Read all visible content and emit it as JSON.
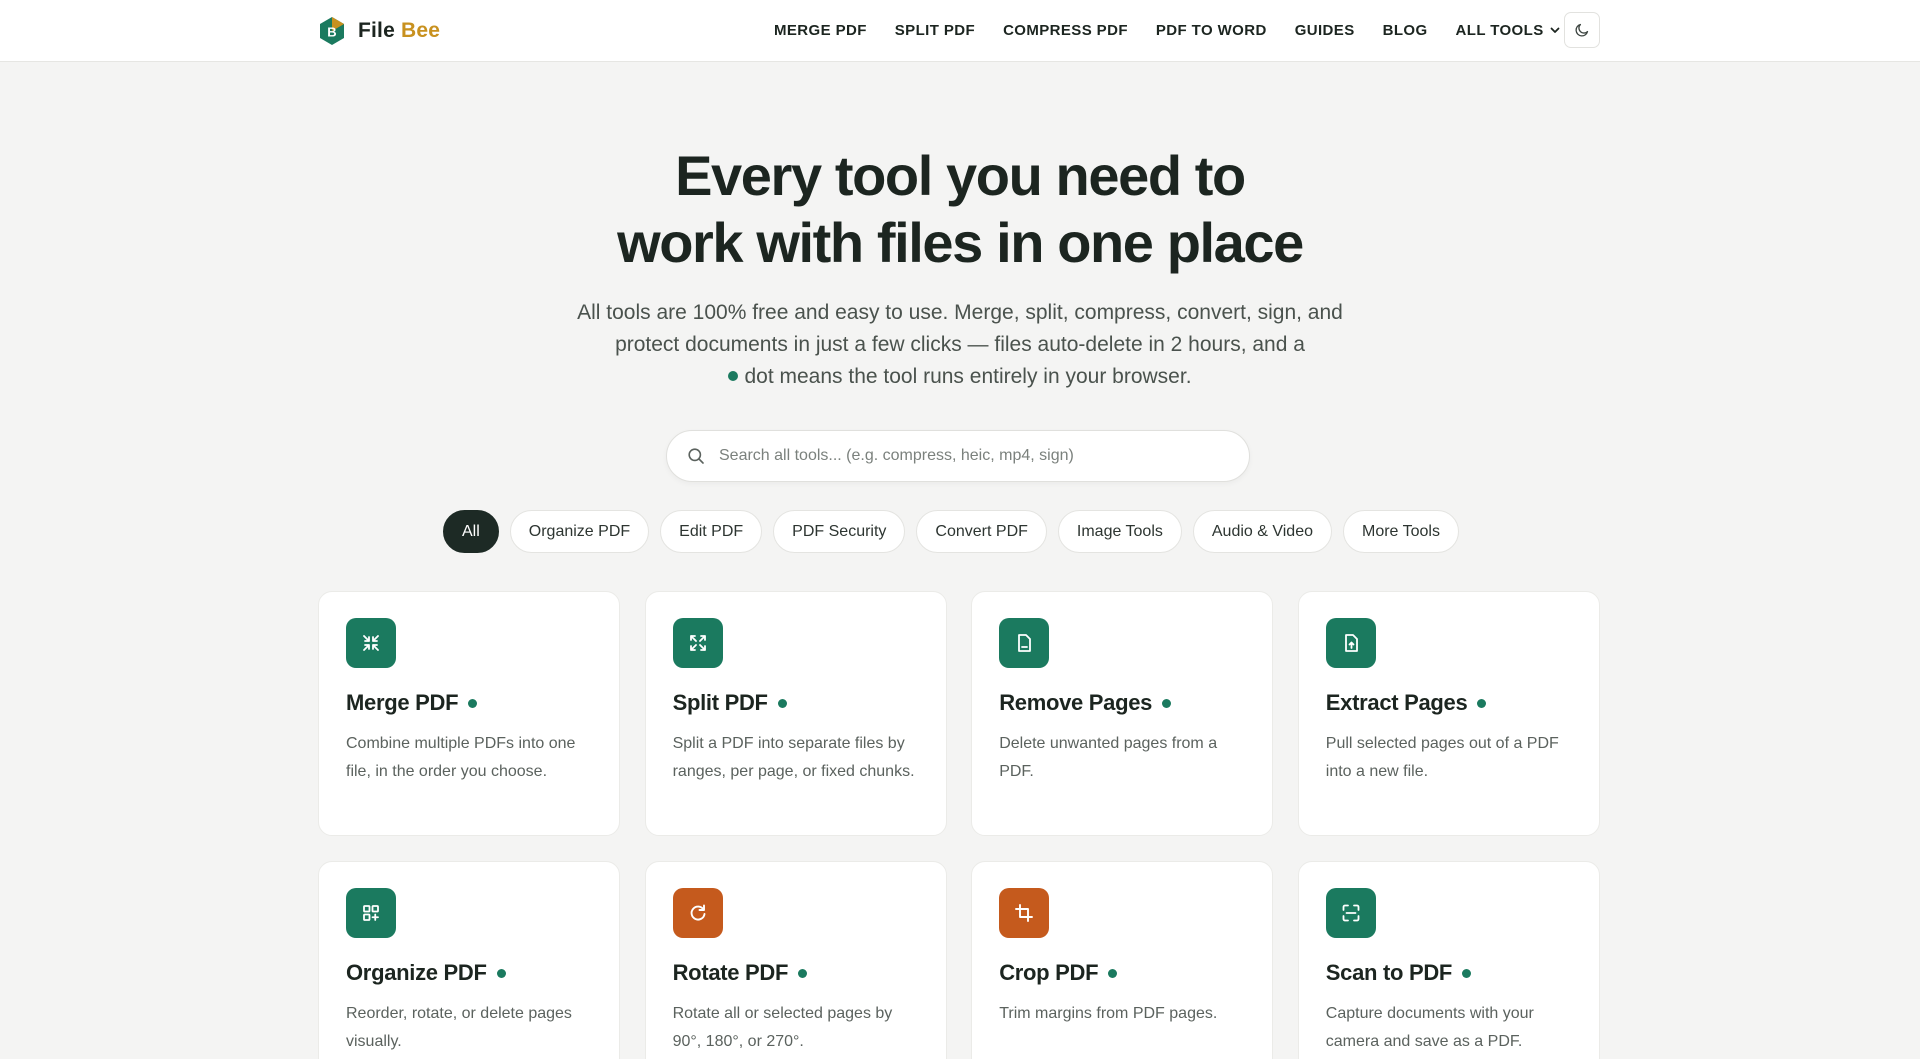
{
  "brand": {
    "name_part1": "File",
    "name_part2": "Bee",
    "mark_letter": "B"
  },
  "nav": {
    "items": [
      "MERGE PDF",
      "SPLIT PDF",
      "COMPRESS PDF",
      "PDF TO WORD",
      "GUIDES",
      "BLOG",
      "ALL TOOLS"
    ]
  },
  "hero": {
    "title_line1": "Every tool you need to",
    "title_line2": "work with files in one place",
    "subtitle_main": "All tools are 100% free and easy to use. Merge, split, compress, convert, sign, and protect documents in just a few clicks — files auto-delete in 2 hours, and a",
    "subtitle_tail": "dot means the tool runs entirely in your browser."
  },
  "search": {
    "placeholder": "Search all tools... (e.g. compress, heic, mp4, sign)",
    "value": ""
  },
  "filters": {
    "selected": "All",
    "items": [
      "All",
      "Organize PDF",
      "Edit PDF",
      "PDF Security",
      "Convert PDF",
      "Image Tools",
      "Audio & Video",
      "More Tools"
    ]
  },
  "tools": [
    {
      "title": "Merge PDF",
      "desc": "Combine multiple PDFs into one file, in the order you choose.",
      "icon": "merge-icon",
      "color": "#1b7a5f"
    },
    {
      "title": "Split PDF",
      "desc": "Split a PDF into separate files by ranges, per page, or fixed chunks.",
      "icon": "split-icon",
      "color": "#1b7a5f"
    },
    {
      "title": "Remove Pages",
      "desc": "Delete unwanted pages from a PDF.",
      "icon": "file-icon",
      "color": "#1b7a5f"
    },
    {
      "title": "Extract Pages",
      "desc": "Pull selected pages out of a PDF into a new file.",
      "icon": "file-export-icon",
      "color": "#1b7a5f"
    },
    {
      "title": "Organize PDF",
      "desc": "Reorder, rotate, or delete pages visually.",
      "icon": "grid-plus-icon",
      "color": "#1b7a5f"
    },
    {
      "title": "Rotate PDF",
      "desc": "Rotate all or selected pages by 90°, 180°, or 270°.",
      "icon": "rotate-icon",
      "color": "#c55a1d"
    },
    {
      "title": "Crop PDF",
      "desc": "Trim margins from PDF pages.",
      "icon": "crop-icon",
      "color": "#c55a1d"
    },
    {
      "title": "Scan to PDF",
      "desc": "Capture documents with your camera and save as a PDF.",
      "icon": "scan-icon",
      "color": "#1b7a5f"
    }
  ]
}
